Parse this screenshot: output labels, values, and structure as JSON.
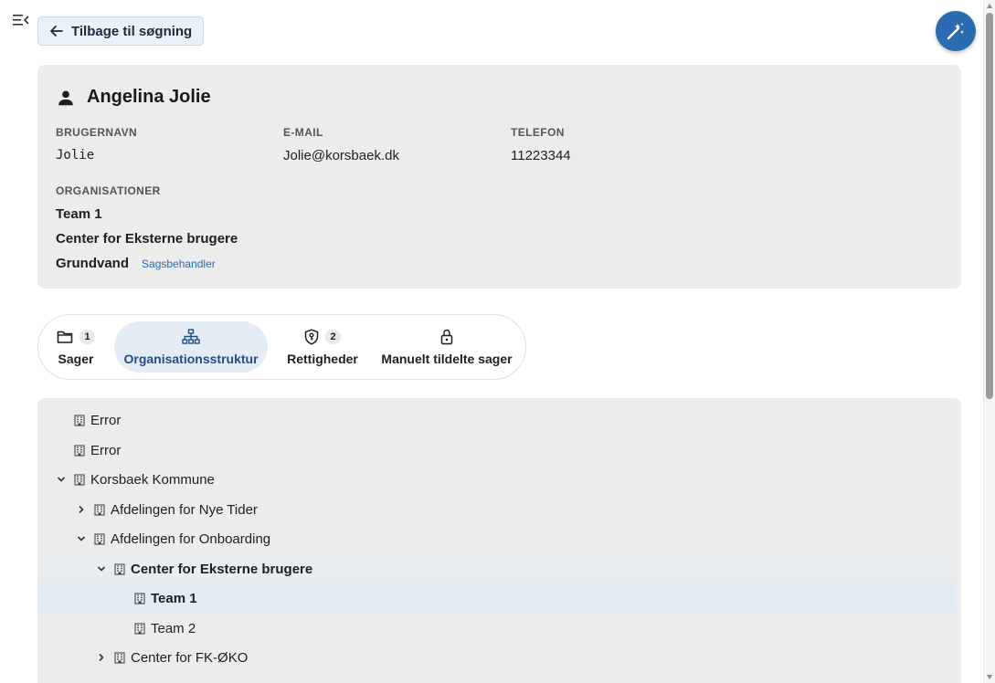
{
  "back_button": {
    "label": "Tilbage til søgning"
  },
  "profile": {
    "name": "Angelina Jolie",
    "fields": {
      "username_label": "BRUGERNAVN",
      "username": "Jolie",
      "email_label": "E-MAIL",
      "email": "Jolie@korsbaek.dk",
      "phone_label": "TELEFON",
      "phone": "11223344"
    },
    "orgs_label": "ORGANISATIONER",
    "orgs": [
      {
        "name": "Team 1",
        "role": ""
      },
      {
        "name": "Center for Eksterne brugere",
        "role": ""
      },
      {
        "name": "Grundvand",
        "role": "Sagsbehandler"
      }
    ]
  },
  "tabs": [
    {
      "label": "Sager",
      "badge": "1",
      "icon": "folder-icon"
    },
    {
      "label": "Organisationsstruktur",
      "badge": "",
      "icon": "org-chart-icon",
      "active": true
    },
    {
      "label": "Rettigheder",
      "badge": "2",
      "icon": "shield-key-icon"
    },
    {
      "label": "Manuelt tildelte sager",
      "badge": "",
      "icon": "lock-icon"
    }
  ],
  "tree": [
    {
      "name": "Error",
      "depth": 0,
      "chevron": "none"
    },
    {
      "name": "Error",
      "depth": 0,
      "chevron": "none"
    },
    {
      "name": "Korsbaek Kommune",
      "depth": 0,
      "chevron": "down"
    },
    {
      "name": "Afdelingen for Nye Tider",
      "depth": 1,
      "chevron": "right"
    },
    {
      "name": "Afdelingen for Onboarding",
      "depth": 1,
      "chevron": "down"
    },
    {
      "name": "Center for Eksterne brugere",
      "depth": 2,
      "chevron": "down",
      "bold": true
    },
    {
      "name": "Team 1",
      "depth": 3,
      "chevron": "none",
      "bold": true,
      "selected": true
    },
    {
      "name": "Team 2",
      "depth": 3,
      "chevron": "none"
    },
    {
      "name": "Center for FK-ØKO",
      "depth": 2,
      "chevron": "right"
    }
  ],
  "colors": {
    "accent": "#2b6cb0",
    "card_bg": "#ececec",
    "selected_bg": "#e3ebf3"
  }
}
